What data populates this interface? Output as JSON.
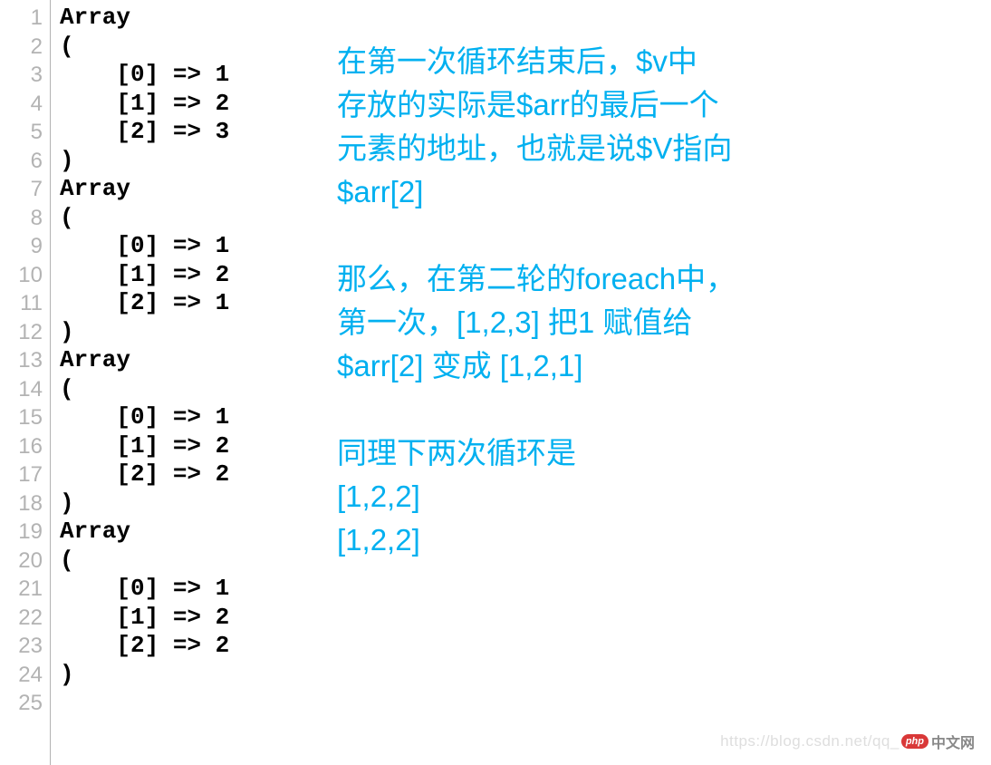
{
  "code": {
    "lines": [
      "Array",
      "(",
      "    [0] => 1",
      "    [1] => 2",
      "    [2] => 3",
      ")",
      "Array",
      "(",
      "    [0] => 1",
      "    [1] => 2",
      "    [2] => 1",
      ")",
      "Array",
      "(",
      "    [0] => 1",
      "    [1] => 2",
      "    [2] => 2",
      ")",
      "Array",
      "(",
      "    [0] => 1",
      "    [1] => 2",
      "    [2] => 2",
      ")",
      ""
    ],
    "lineNumbers": [
      "1",
      "2",
      "3",
      "4",
      "5",
      "6",
      "7",
      "8",
      "9",
      "10",
      "11",
      "12",
      "13",
      "14",
      "15",
      "16",
      "17",
      "18",
      "19",
      "20",
      "21",
      "22",
      "23",
      "24",
      "25"
    ]
  },
  "annotation": {
    "para1_l1": "在第一次循环结束后，$v中",
    "para1_l2": "存放的实际是$arr的最后一个",
    "para1_l3": "元素的地址，也就是说$V指向",
    "para1_l4": "$arr[2]",
    "para2_l1": "那么，在第二轮的foreach中，",
    "para2_l2": "第一次，[1,2,3] 把1 赋值给",
    "para2_l3": "$arr[2] 变成 [1,2,1]",
    "para3_l1": "同理下两次循环是",
    "para3_l2": "[1,2,2]",
    "para3_l3": "[1,2,2]"
  },
  "watermark": {
    "url": "https://blog.csdn.net/qq_",
    "badge": "php",
    "cn": "中文网"
  }
}
